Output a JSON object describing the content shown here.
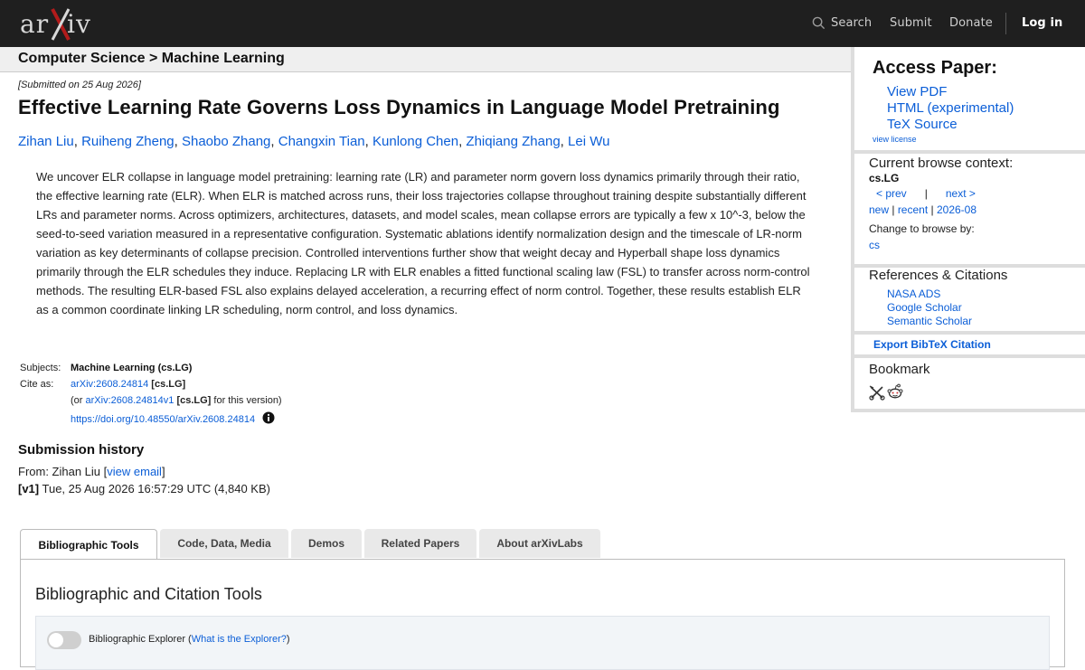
{
  "topbar": {
    "logo_text": "arXiv",
    "search_label": "Search",
    "submit_label": "Submit",
    "donate_label": "Donate",
    "login_label": "Log in"
  },
  "breadcrumb": {
    "parent": "Computer Science",
    "separator": ">",
    "current": "Machine Learning"
  },
  "paper": {
    "submitted": "[Submitted on 25 Aug 2026]",
    "title": "Effective Learning Rate Governs Loss Dynamics in Language Model Pretraining",
    "authors": [
      "Zihan Liu",
      "Ruiheng Zheng",
      "Shaobo Zhang",
      "Changxin Tian",
      "Kunlong Chen",
      "Zhiqiang Zhang",
      "Lei Wu"
    ],
    "abstract": "We uncover ELR collapse in language model pretraining: learning rate (LR) and parameter norm govern loss dynamics primarily through their ratio, the effective learning rate (ELR). When ELR is matched across runs, their loss trajectories collapse throughout training despite substantially different LRs and parameter norms. Across optimizers, architectures, datasets, and model scales, mean collapse errors are typically a few x 10^-3, below the seed-to-seed variation measured in a representative configuration. Systematic ablations identify normalization design and the timescale of LR-norm variation as key determinants of collapse precision. Controlled interventions further show that weight decay and Hyperball shape loss dynamics primarily through the ELR schedules they induce. Replacing LR with ELR enables a fitted functional scaling law (FSL) to transfer across norm-control methods. The resulting ELR-based FSL also explains delayed acceleration, a recurring effect of norm control. Together, these results establish ELR as a common coordinate linking LR scheduling, norm control, and loss dynamics."
  },
  "meta": {
    "subjects_label": "Subjects:",
    "subjects_value": "Machine Learning (cs.LG)",
    "cite_label": "Cite as:",
    "cite_id": "arXiv:2608.24814",
    "cite_cat": "[cs.LG]",
    "version_prefix": "(or",
    "version_id": "arXiv:2608.24814v1",
    "version_cat": "[cs.LG]",
    "version_suffix": "for this version)",
    "doi": "https://doi.org/10.48550/arXiv.2608.24814"
  },
  "history": {
    "title": "Submission history",
    "from_prefix": "From: Zihan Liu [",
    "view_email": "view email",
    "from_suffix": "]",
    "v1_label": "[v1]",
    "v1_text": "Tue, 25 Aug 2026 16:57:29 UTC (4,840 KB)"
  },
  "tabs": [
    {
      "label": "Bibliographic Tools"
    },
    {
      "label": "Code, Data, Media"
    },
    {
      "label": "Demos"
    },
    {
      "label": "Related Papers"
    },
    {
      "label": "About arXivLabs"
    }
  ],
  "panel": {
    "title": "Bibliographic and Citation Tools",
    "explorer_label": "Bibliographic Explorer (",
    "explorer_link": "What is the Explorer?",
    "explorer_suffix": ")"
  },
  "sidebar": {
    "access_title": "Access Paper:",
    "view_pdf": "View PDF",
    "html": "HTML (experimental)",
    "tex": "TeX Source",
    "view_license": "view license",
    "context_title": "Current browse context:",
    "context_value": "cs.LG",
    "prev": "< prev",
    "pipe": "|",
    "next": "next >",
    "new": "new",
    "recent": "recent",
    "month": "2026-08",
    "change_browse": "Change to browse by:",
    "cs": "cs",
    "refs_title": "References & Citations",
    "nasa": "NASA ADS",
    "google": "Google Scholar",
    "semantic": "Semantic Scholar",
    "export": "Export BibTeX Citation",
    "bookmark_title": "Bookmark"
  },
  "colors": {
    "topbar": "#1f1f1f",
    "logo_x": "#b31b1b",
    "link": "#0b5ed7"
  }
}
